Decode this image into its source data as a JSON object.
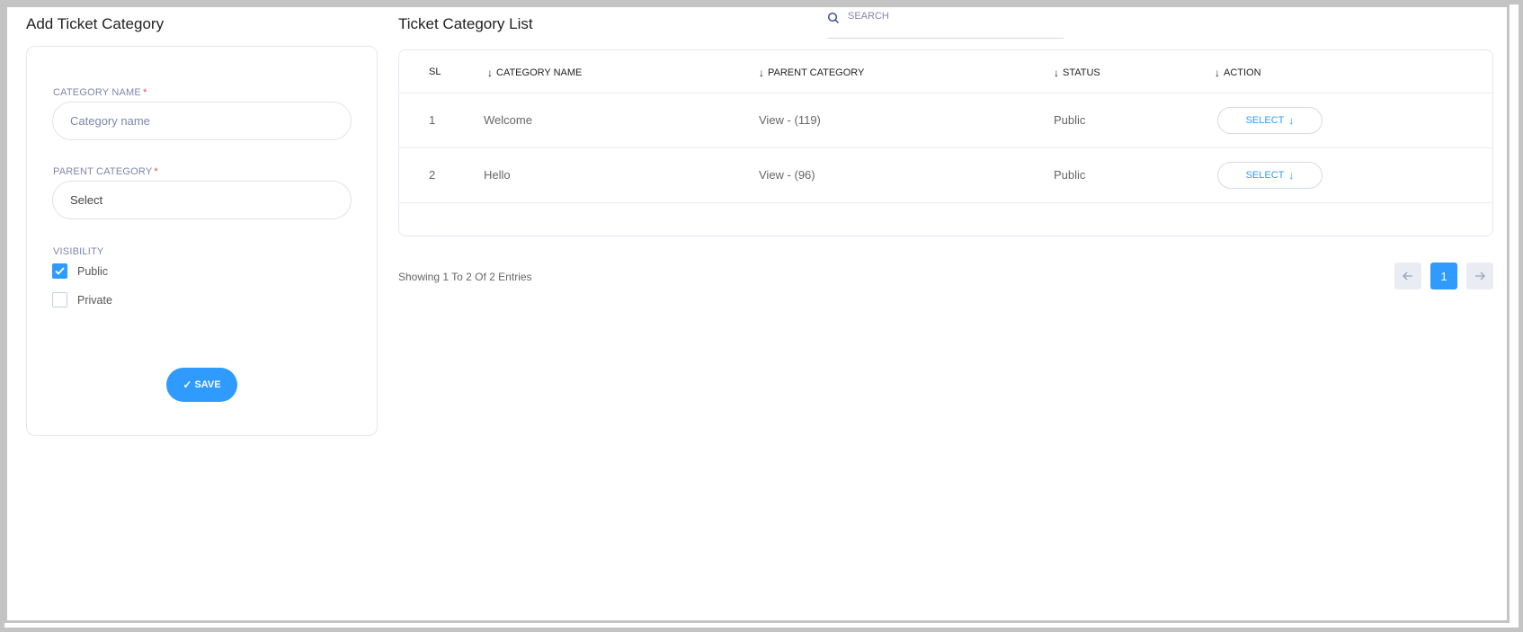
{
  "left_panel": {
    "title": "Add Ticket Category",
    "category_name": {
      "label": "CATEGORY NAME",
      "required_mark": "*",
      "placeholder": "Category name",
      "value": ""
    },
    "parent_category": {
      "label": "PARENT CATEGORY",
      "required_mark": "*",
      "selected": "Select"
    },
    "visibility": {
      "label": "VISIBILITY",
      "options": [
        {
          "label": "Public",
          "checked": true
        },
        {
          "label": "Private",
          "checked": false
        }
      ]
    },
    "save_label": "SAVE"
  },
  "right_panel": {
    "title": "Ticket Category List",
    "search_placeholder": "SEARCH",
    "columns": [
      "SL",
      "CATEGORY NAME",
      "PARENT CATEGORY",
      "STATUS",
      "ACTION"
    ],
    "rows": [
      {
        "sl": "1",
        "name": "Welcome",
        "parent": "View - (119)",
        "status": "Public",
        "action": "SELECT"
      },
      {
        "sl": "2",
        "name": "Hello",
        "parent": "View - (96)",
        "status": "Public",
        "action": "SELECT"
      }
    ],
    "showing_text": "Showing 1 To 2 Of 2 Entries",
    "pagination": {
      "current_page": "1"
    }
  },
  "colors": {
    "accent": "#2f9bff",
    "label": "#7e86ad",
    "border": "#e4e7f0",
    "frame": "#c4c4c4"
  },
  "icons": {
    "search": "search-icon",
    "check": "check-icon",
    "sort": "arrow-down-icon",
    "prev": "arrow-left-icon",
    "next": "arrow-right-icon"
  }
}
